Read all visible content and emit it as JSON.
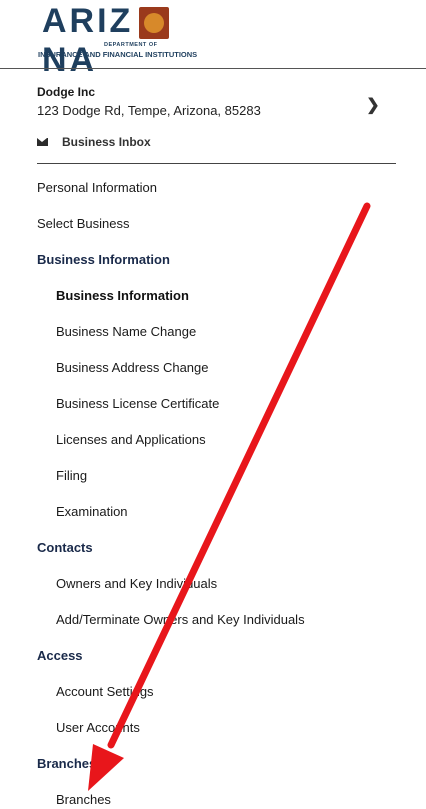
{
  "logo": {
    "wordmark": "ARIZONA",
    "subtitle_top": "DEPARTMENT OF",
    "subtitle_bottom": "INSURANCE AND FINANCIAL INSTITUTIONS"
  },
  "business": {
    "name": "Dodge Inc",
    "address": "123 Dodge Rd, Tempe, Arizona, 85283"
  },
  "inbox": {
    "label": "Business Inbox"
  },
  "nav": {
    "personal_information": "Personal Information",
    "select_business": "Select Business",
    "business_information_section": "Business Information",
    "business_information": "Business Information",
    "business_name_change": "Business Name Change",
    "business_address_change": "Business Address Change",
    "business_license_certificate": "Business License Certificate",
    "licenses_and_applications": "Licenses and Applications",
    "filing": "Filing",
    "examination": "Examination",
    "contacts_section": "Contacts",
    "owners_and_key_individuals": "Owners and Key Individuals",
    "add_terminate_owners": "Add/Terminate Owners and Key Individuals",
    "access_section": "Access",
    "account_settings": "Account Settings",
    "user_accounts": "User Accounts",
    "branches_section": "Branches",
    "branches": "Branches"
  },
  "annotation": {
    "arrow_color": "#e8161b"
  }
}
